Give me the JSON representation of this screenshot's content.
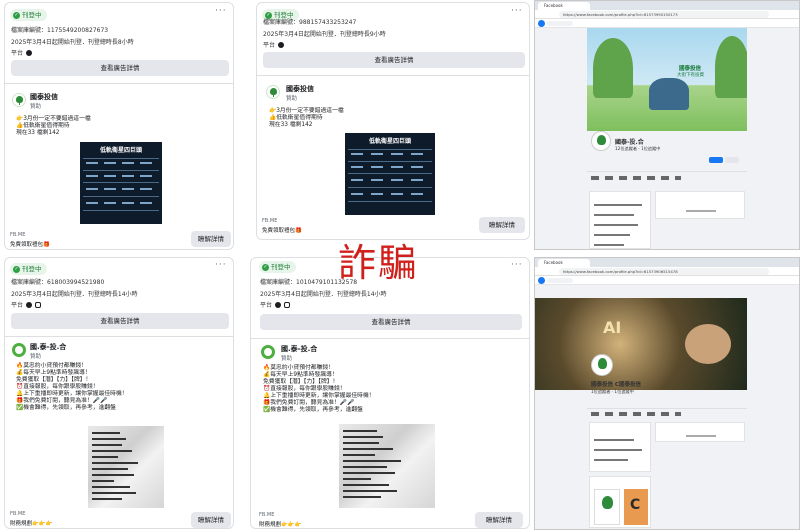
{
  "status_label": "刊登中",
  "see_ad_details": "查看廣告詳情",
  "platform_label": "平台",
  "sponsored": "贊助",
  "learn_more": "瞭解詳情",
  "fb_label": "FB.ME",
  "scam_label": "詐騙",
  "ads": [
    {
      "id_label": "檔案庫編號：1175549200827673",
      "date_label": "2025年3月4日起開始刊登．刊登總時長8小時",
      "advertiser": "國泰投信",
      "body": [
        "👉3月份一定不要錯過這一檔",
        "👍低軌衛星值得期待",
        "現在33 檔剩142"
      ],
      "image_title": "低軌衛星四巨頭",
      "footer_sub": "免費領取禮包🎁"
    },
    {
      "id_label": "檔案庫編號：988157433253247",
      "date_label": "2025年3月4日起開始刊登．刊登總時長9小時",
      "advertiser": "國泰投信",
      "body": [
        "👉3月份一定不要錯過這一檔",
        "👍低軌衛星值得期待",
        "現在33 檔剩142"
      ],
      "image_title": "低軌衛星四巨頭",
      "footer_sub": "免費領取禮包🎁"
    },
    {
      "id_label": "檔案庫編號：618003994521980",
      "date_label": "2025年3月4日起開始刊登．刊登總時長14小時",
      "advertiser": "國.泰-投.合",
      "body": [
        "🔥莫忠約小貸預付都賺錢！",
        "💰每天早上9點準時發飆導！",
        "免費獲取【潛】【力】【牌】！",
        "⏰直接報股，每你跟學股賺錢！",
        "🔔上下重播即時更新，讓你掌握最佳時機！",
        "🎁我們免費訂閱，聽見為准！🎤🎤",
        "✅機會難得，先領取，再參考，進翻盤"
      ],
      "footer_sub": "財務規劃👉👉👉"
    },
    {
      "id_label": "檔案庫編號：1010479101132578",
      "date_label": "2025年3月4日起開始刊登．刊登總時長14小時",
      "advertiser": "國.泰-投.合",
      "body": [
        "🔥莫忠約小貸預付都賺錢！",
        "💰每天早上9點準時發飆導！",
        "免費獲取【潛】【力】【牌】！",
        "⏰直接報股，每你跟學股賺錢！",
        "🔔上下重播即時更新，讓你掌握最佳時機！",
        "🎁我們免費訂閱，聽見為准！🎤🎤",
        "✅機會難得，先領取，再參考，進翻盤"
      ],
      "footer_sub": "財務規劃👉👉👉"
    }
  ],
  "browsers": [
    {
      "tab_title": "Facebook",
      "url": "https://www.facebook.com/profile.php?id=61573990150173",
      "cover_text": [
        "國泰投信",
        "大街下有投資"
      ],
      "page_name": "國泰-投.合",
      "page_sub": "12位追蹤者 · 1位追蹤中"
    },
    {
      "tab_title": "Facebook",
      "url": "https://www.facebook.com/profile.php?id=61573906515478",
      "cover_text": [
        "AI"
      ],
      "page_name": "國泰投信 C國泰投信",
      "page_sub": "1位追蹤者 · 1位追蹤中"
    }
  ],
  "colors": {
    "scam": "#d0201c",
    "status_green": "#2e9e45",
    "fb_blue": "#1877f2"
  }
}
